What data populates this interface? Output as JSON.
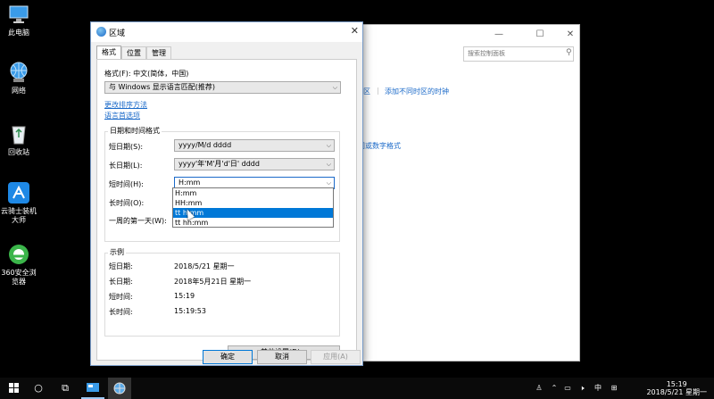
{
  "desktop": {
    "icons": [
      {
        "label": "此电脑",
        "icon": "this-pc-icon"
      },
      {
        "label": "网络",
        "icon": "network-icon"
      },
      {
        "label": "回收站",
        "icon": "recycle-bin-icon"
      },
      {
        "label": "云骑士装机大师",
        "icon": "yunqishi-icon"
      },
      {
        "label": "360安全浏览器",
        "icon": "360-browser-icon"
      }
    ]
  },
  "control_panel": {
    "search_placeholder": "搜索控制面板",
    "link_region_tail": "区",
    "link_clock": "添加不同时区的时钟",
    "link_formats_tail": "间或数字格式"
  },
  "dialog": {
    "title": "区域",
    "tabs": [
      "格式",
      "位置",
      "管理"
    ],
    "format_label": "格式(F): 中文(简体，中国)",
    "format_value": "与 Windows 显示语言匹配(推荐)",
    "link_sort": "更改排序方法",
    "link_lang_pref": "语言首选项",
    "datetime_group": "日期和时间格式",
    "short_date_label": "短日期(S):",
    "short_date_value": "yyyy/M/d dddd",
    "long_date_label": "长日期(L):",
    "long_date_value": "yyyy'年'M'月'd'日' dddd",
    "short_time_label": "短时间(H):",
    "short_time_value": "H:mm",
    "long_time_label": "长时间(O):",
    "first_day_label": "一周的第一天(W):",
    "dropdown_options": [
      "H:mm",
      "HH:mm",
      "tt h:mm",
      "tt hh:mm"
    ],
    "dropdown_selected_index": 2,
    "example_group": "示例",
    "examples": [
      {
        "label": "短日期:",
        "value": "2018/5/21 星期一"
      },
      {
        "label": "长日期:",
        "value": "2018年5月21日 星期一"
      },
      {
        "label": "短时间:",
        "value": "15:19"
      },
      {
        "label": "长时间:",
        "value": "15:19:53"
      }
    ],
    "other_settings": "其他设置(D)...",
    "ok": "确定",
    "cancel": "取消",
    "apply": "应用(A)"
  },
  "taskbar": {
    "tray_ime": "中",
    "time": "15:19",
    "date": "2018/5/21 星期一"
  },
  "colors": {
    "accent": "#0078d7",
    "link": "#1b6ac9"
  }
}
